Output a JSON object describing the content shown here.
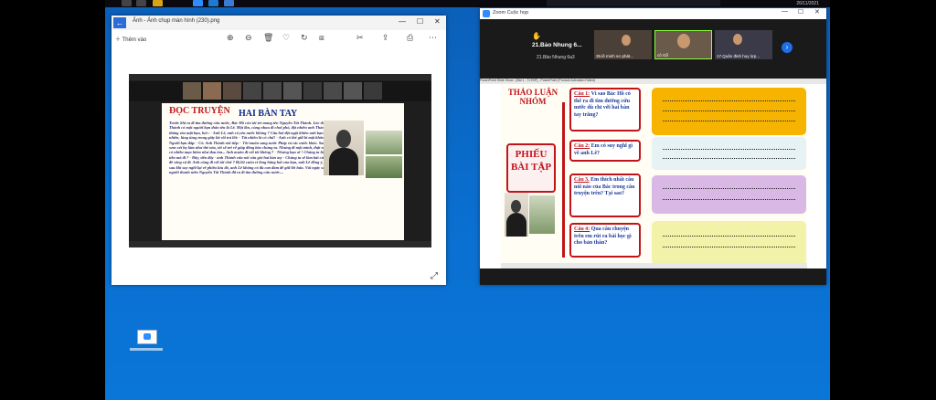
{
  "taskbar": {
    "tray_time": "26/11/2021"
  },
  "photo_viewer": {
    "title": "Ảnh - Ảnh chụp màn hình (230).png",
    "add_label": "Thêm vào",
    "toolbar_icons": [
      "zoom-in-icon",
      "zoom-out-icon",
      "delete-icon",
      "heart-icon",
      "rotate-icon",
      "crop-icon",
      "edit-icon",
      "share-icon",
      "print-icon",
      "more-icon"
    ],
    "story": {
      "title_1": "ĐỌC TRUYỆN",
      "title_2": "HAI BÀN TAY",
      "text": "Trước khi ra đi tìm đường cứu nước, Bác Hồ còn tôi trẻ mang tên Nguyễn Tất Thành. Lúc đó, anh Thành có một người bạn thân tên là Lê. Một lần, cùng nhau đi chơi phố, đột nhiên anh Thành nêu thắng vào mặt bạn, hỏi : - Anh Lê, anh có yêu nước không ? Câu hỏi đột ngột khiến anh bạn ngạc nhiên, lúng túng trong giây lát rồi trả lời: - Tất nhiên là có chứ! - Anh có thể giữ bí mật không? Người bạn đáp: - Có. Anh Thành nói tiếp: - Tôi muốn sang nước Pháp và các nước khác. Sau khi xem xét họ làm như thế nào, tôi sẽ trở về giúp đồng bào chúng ta. Nhưng đi một mình, thật ra cũng có nhiều mạo hiểm như đau ốm... Anh muốn đi với tôi không ? - Nhưng bạn ơi ! Chúng ta lấy đâu ra tiền mà đi ? - Đây, tiền đây - anh Thành vừa nói vừa giơ hai bàn tay - Chúng ta sẽ làm bất cứ việc gì để sống và đi. Anh cùng đi với tôi chứ ? Bị lôi cuốn vì lòng hăng hái của bạn, anh Lê đồng ý, nhưng sau khi suy nghĩ lại về phiêu lưu đó, anh Lê không có đủ can đảm để giữ lời hứa. Vài ngày sau, người thanh niên Nguyễn Tất Thành đã ra đi tìm đường cứu nước...."
    }
  },
  "zoom": {
    "title": "Zoom Cuộc họp",
    "presenter_name": "21.Bảo Nhung 6...",
    "presenter_sub": "21.Bảo Nhung 6a3",
    "tiles": [
      {
        "label": "35.lê minh sơ phát..."
      },
      {
        "label": "cô Gỗ"
      },
      {
        "label": "17.Quân đinh huy lợp..."
      }
    ],
    "ppt_title": "PowerPoint Slide Show - [Bài 1 - TLTĐP] - PowerPoint (Product Activation Failed)",
    "slide": {
      "discussion_label": "THẢO LUẬN NHÓM",
      "worksheet_label": "PHIẾU BÀI TẬP",
      "questions": [
        {
          "num": "Câu 1:",
          "text": "Vì sao Bác Hồ có thể ra đi tìm đường cứu nước dù chỉ với hai bàn tay trắng?"
        },
        {
          "num": "Câu 2:",
          "text": "Em có suy nghĩ gì về anh Lê?"
        },
        {
          "num": "Câu 3.",
          "text": "Em thích nhất câu nói nào của Bác trong câu truyện trên? Tại sao?"
        },
        {
          "num": "Câu 4:",
          "text": "Qua câu chuyện trên em rút ra bài học gì cho bản thân?"
        }
      ],
      "answer_colors": [
        "#f6b300",
        "#e6f2f4",
        "#d9b8e6",
        "#f2f2a8"
      ]
    }
  }
}
